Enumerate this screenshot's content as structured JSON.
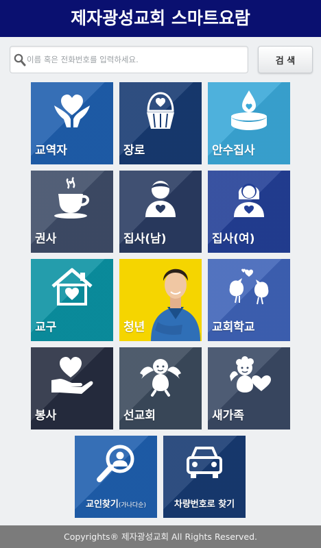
{
  "header": {
    "title": "제자광성교회 스마트요람"
  },
  "search": {
    "placeholder": "이름 혹은 전화번호를 입력하세요.",
    "button_label": "검 색"
  },
  "tiles": [
    {
      "label": "교역자",
      "color": "#1f5fae",
      "icon": "hands-heart-icon"
    },
    {
      "label": "장로",
      "color": "#173a72",
      "icon": "cupcake-heart-icon"
    },
    {
      "label": "안수집사",
      "color": "#3aa8d8",
      "icon": "candle-heart-icon"
    },
    {
      "label": "권사",
      "color": "#3f4d68",
      "icon": "teacup-icon"
    },
    {
      "label": "집사(남)",
      "color": "#2a3c62",
      "icon": "man-heart-icon"
    },
    {
      "label": "집사(여)",
      "color": "#233f96",
      "icon": "woman-heart-icon"
    },
    {
      "label": "교구",
      "color": "#0b92a3",
      "icon": "house-heart-icon"
    },
    {
      "label": "청년",
      "color": "#f5d500",
      "icon": "young-man-photo"
    },
    {
      "label": "교회학교",
      "color": "#3f63b8",
      "icon": "lovebirds-icon"
    },
    {
      "label": "봉사",
      "color": "#262d40",
      "icon": "hand-heart-icon"
    },
    {
      "label": "선교회",
      "color": "#3b4a5c",
      "icon": "angel-icon"
    },
    {
      "label": "새가족",
      "color": "#3a4964",
      "icon": "cherub-heart-icon"
    },
    {
      "label": "교인찾기",
      "label_small": "(가나다순)",
      "color": "#1f5fae",
      "icon": "magnifier-person-icon"
    },
    {
      "label": "차량번호로 찾기",
      "color": "#173a72",
      "icon": "car-icon"
    }
  ],
  "footer": {
    "text": "Copyrights® 제자광성교회 All Rights Reserved."
  }
}
